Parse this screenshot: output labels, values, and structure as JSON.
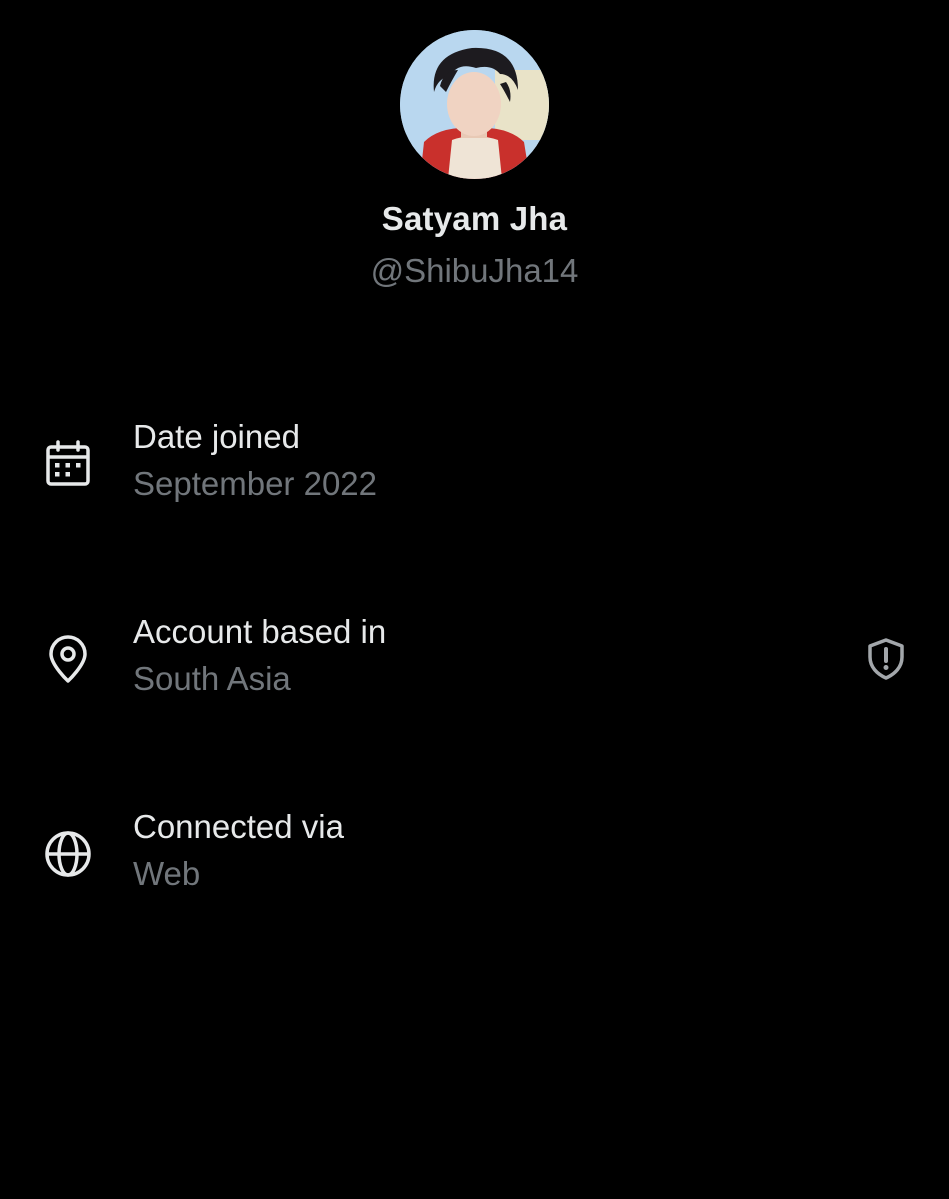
{
  "profile": {
    "display_name": "Satyam Jha",
    "handle": "@ShibuJha14"
  },
  "about": {
    "rows": [
      {
        "icon": "calendar-icon",
        "label": "Date joined",
        "value": "September 2022"
      },
      {
        "icon": "location-pin-icon",
        "label": "Account based in",
        "value": "South Asia",
        "trailing_icon": "shield-alert-icon"
      },
      {
        "icon": "globe-icon",
        "label": "Connected via",
        "value": "Web"
      }
    ]
  },
  "colors": {
    "background": "#000000",
    "primary_text": "#e7e9ea",
    "secondary_text": "#71767b",
    "icon": "#e7e9ea",
    "trailing_icon": "#a3a7ab"
  }
}
